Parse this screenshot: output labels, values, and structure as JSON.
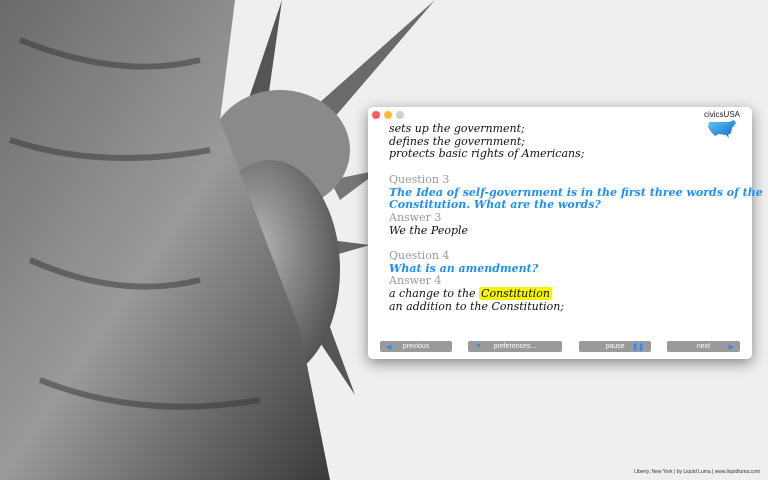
{
  "credit": "Liberty, New York | by Liquid Luma | www.liquidluma.com",
  "app": {
    "logo": "civicsUSA"
  },
  "content": {
    "lines_top": [
      "sets up the government;",
      "defines the government;",
      "protects basic rights of Americans;"
    ],
    "q3_label": "Question 3",
    "q3_text_1": "The Idea of self-government is in the first three words of the",
    "q3_text_2": "Constitution. What are the words?",
    "a3_label": "Answer 3",
    "a3_text": "We the People",
    "q4_label": "Question 4",
    "q4_text": "What is an amendment?",
    "a4_label": "Answer 4",
    "a4_prefix": "a change to the",
    "a4_highlight": "Constitution",
    "a4_line2": "an addition to the Constitution;"
  },
  "buttons": {
    "previous": "previous",
    "preferences": "preferences...",
    "pause": "pause",
    "next": "next"
  },
  "colors": {
    "accent": "#1f8ff0",
    "highlight": "#f5f500",
    "button": "#9a9a9a"
  }
}
